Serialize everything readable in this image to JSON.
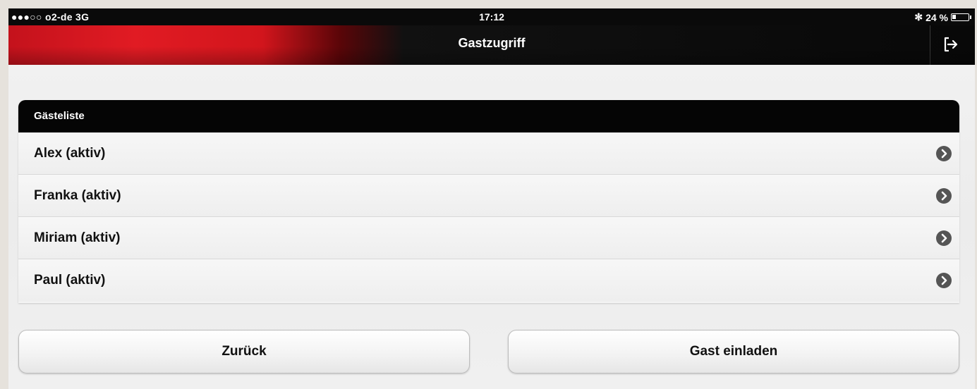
{
  "statusbar": {
    "carrier": "●●●○○ o2-de  3G",
    "time": "17:12",
    "bluetooth": "✻",
    "battery": "24 %",
    "battery_level": 0.24
  },
  "navbar": {
    "title": "Gastzugriff",
    "exit_icon": "exit-icon"
  },
  "guest_list": {
    "header": "Gästeliste",
    "items": [
      {
        "label": "Alex (aktiv)"
      },
      {
        "label": "Franka (aktiv)"
      },
      {
        "label": "Miriam (aktiv)"
      },
      {
        "label": "Paul (aktiv)"
      }
    ],
    "chevron_icon": "chevron-right-circle-icon"
  },
  "actions": {
    "back_label": "Zurück",
    "invite_label": "Gast einladen"
  },
  "colors": {
    "brand_red": "#e11b23",
    "header_black": "#050505",
    "background": "#f0f0f0"
  }
}
